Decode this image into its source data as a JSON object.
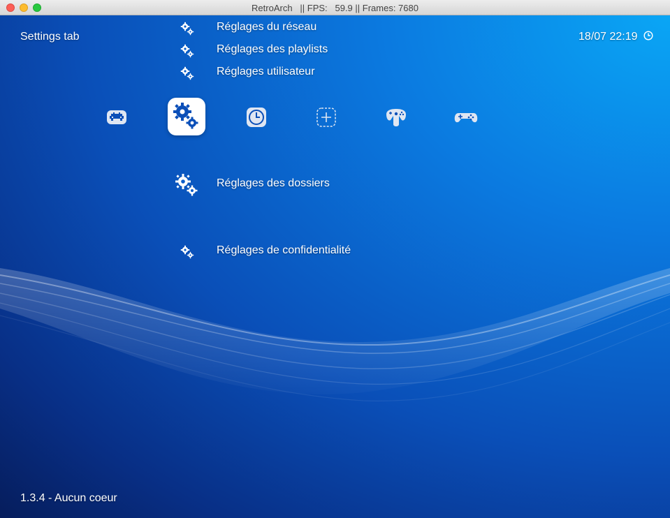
{
  "window": {
    "title": "RetroArch   || FPS:   59.9 || Frames: 7680"
  },
  "header": {
    "title": "Settings tab",
    "clock": "18/07 22:19"
  },
  "tabs": [
    {
      "icon": "retroarch-invader-icon",
      "active": false
    },
    {
      "icon": "settings-gears-icon",
      "active": true
    },
    {
      "icon": "history-clock-icon",
      "active": false
    },
    {
      "icon": "add-content-icon",
      "active": false
    },
    {
      "icon": "n64-controller-icon",
      "active": false
    },
    {
      "icon": "gamepad-icon",
      "active": false
    }
  ],
  "menu": {
    "above": [
      {
        "label": "Réglages du réseau"
      },
      {
        "label": "Réglages des playlists"
      },
      {
        "label": "Réglages utilisateur"
      }
    ],
    "selected": {
      "label": "Réglages des dossiers"
    },
    "below": [
      {
        "label": "Réglages de confidentialité"
      }
    ]
  },
  "footer": {
    "version": "1.3.4 - Aucun coeur"
  },
  "colors": {
    "background_top_right": "#0aa6f5",
    "background_mid": "#0a4fb8",
    "background_bottom_left": "#061d5c",
    "text": "#ffffff"
  }
}
